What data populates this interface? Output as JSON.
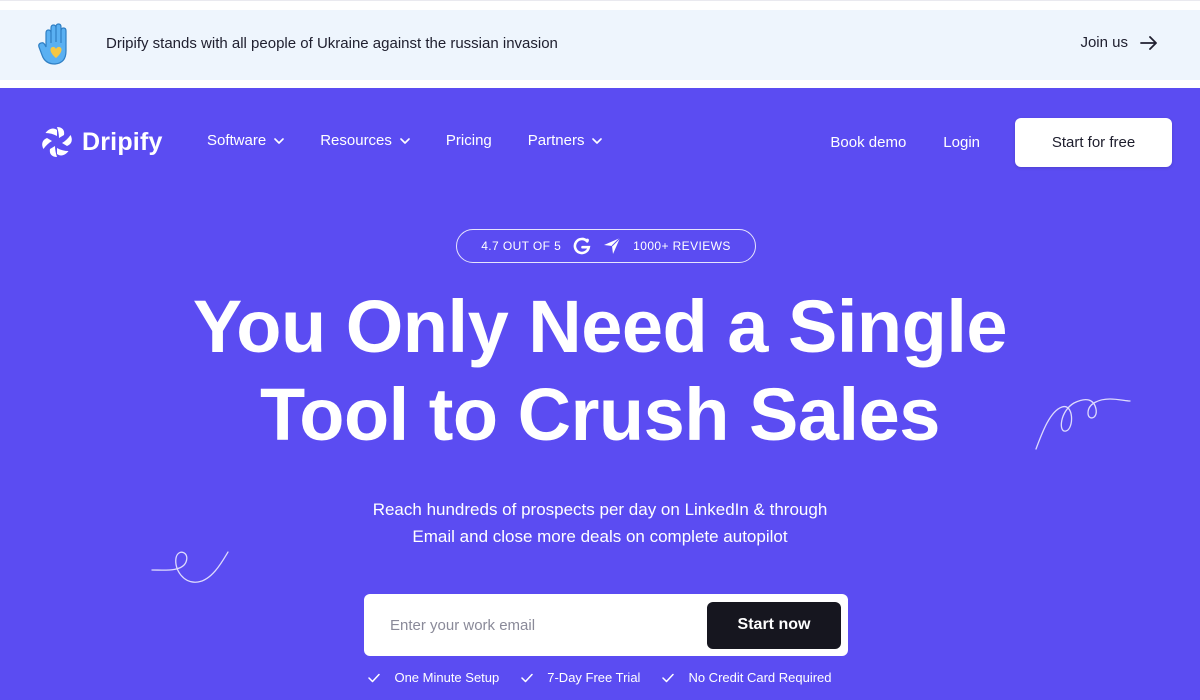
{
  "banner": {
    "text": "Dripify stands with all people of Ukraine against the russian invasion",
    "join_label": "Join us",
    "hand_icon": "hand-heart-icon",
    "colors": {
      "hand": "#5ab0f2",
      "heart": "#f6c744",
      "background": "#eef5fd"
    }
  },
  "nav": {
    "logo_text": "Dripify",
    "items": [
      {
        "label": "Software",
        "has_dropdown": true
      },
      {
        "label": "Resources",
        "has_dropdown": true
      },
      {
        "label": "Pricing",
        "has_dropdown": false
      },
      {
        "label": "Partners",
        "has_dropdown": true
      }
    ],
    "book_demo": "Book demo",
    "login": "Login",
    "start_free": "Start for free"
  },
  "hero": {
    "background_color": "#5b4cf2",
    "rating": {
      "score_text": "4.7 OUT OF 5",
      "reviews_text": "1000+ REVIEWS",
      "icons": [
        "g2-icon",
        "capterra-icon"
      ]
    },
    "headline_line1": "You Only Need a Single",
    "headline_line2": "Tool to Crush Sales",
    "subtext_line1": "Reach hundreds of prospects per day on LinkedIn & through",
    "subtext_line2": "Email and close more deals on complete autopilot",
    "email_placeholder": "Enter your work email",
    "cta_label": "Start now",
    "features": [
      "One Minute Setup",
      "7-Day Free Trial",
      "No Credit Card Required"
    ]
  }
}
